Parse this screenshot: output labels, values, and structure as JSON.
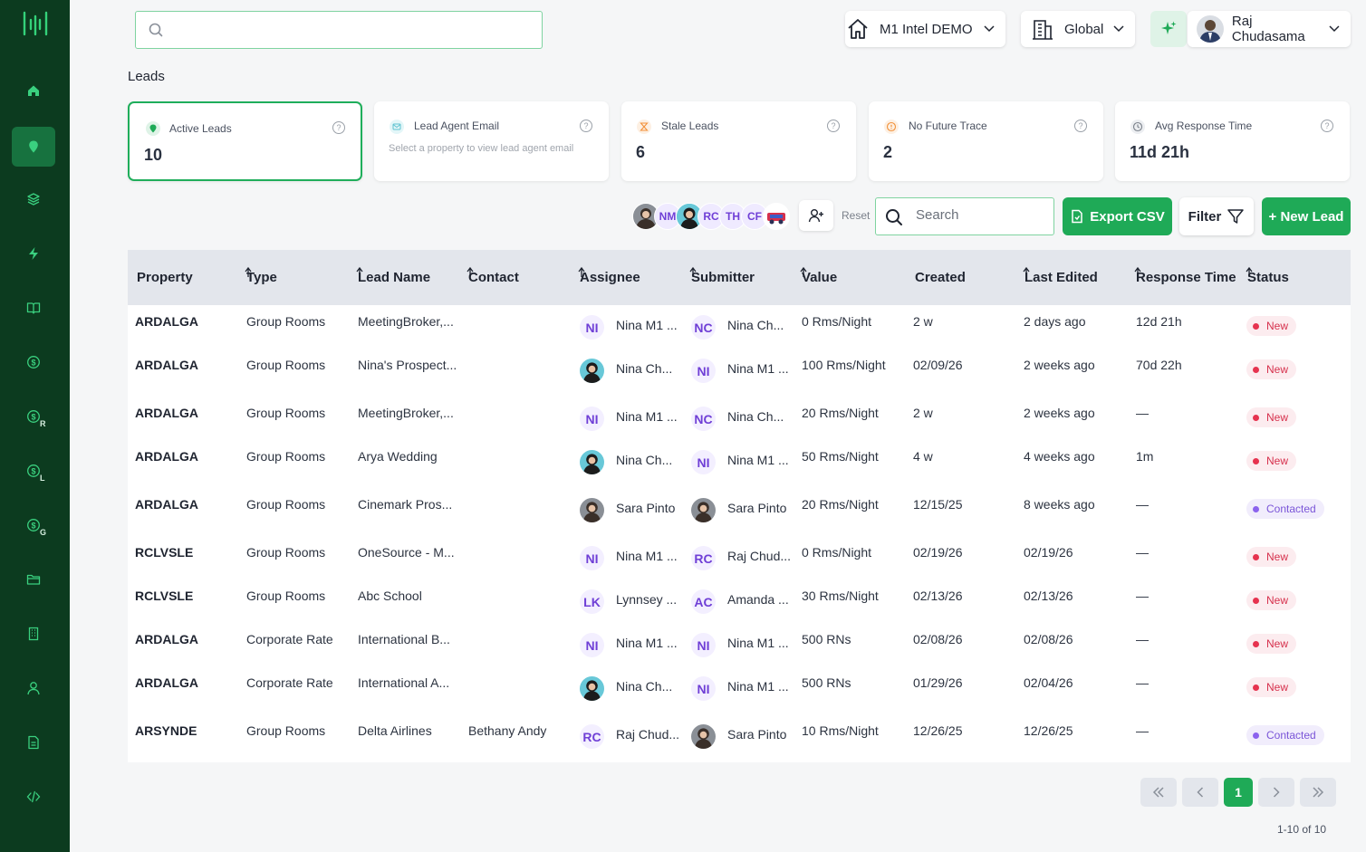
{
  "nav": {
    "items": [
      {
        "name": "home",
        "sub": ""
      },
      {
        "name": "leads",
        "sub": ""
      },
      {
        "name": "layers",
        "sub": ""
      },
      {
        "name": "bolt",
        "sub": ""
      },
      {
        "name": "book",
        "sub": ""
      },
      {
        "name": "dollar",
        "sub": ""
      },
      {
        "name": "dollar-r",
        "sub": "R"
      },
      {
        "name": "dollar-l",
        "sub": "L"
      },
      {
        "name": "dollar-g",
        "sub": "G"
      },
      {
        "name": "folder",
        "sub": ""
      },
      {
        "name": "building",
        "sub": ""
      },
      {
        "name": "user",
        "sub": ""
      },
      {
        "name": "file",
        "sub": ""
      },
      {
        "name": "code",
        "sub": ""
      }
    ],
    "active_index": 1
  },
  "header": {
    "search_placeholder": "",
    "property_select": "M1 Intel DEMO",
    "scope_select": "Global",
    "user_name": "Raj Chudasama"
  },
  "page": {
    "title": "Leads"
  },
  "cards": {
    "active_leads": {
      "label": "Active Leads",
      "value": "10"
    },
    "lead_agent_email": {
      "label": "Lead Agent Email",
      "sub": "Select a property to view lead agent email"
    },
    "stale_leads": {
      "label": "Stale Leads",
      "value": "6"
    },
    "no_future_trace": {
      "label": "No Future Trace",
      "value": "2"
    },
    "avg_response": {
      "label": "Avg Response Time",
      "value": "11d 21h"
    }
  },
  "toolbar": {
    "avatars": [
      "NM",
      "RC",
      "TH",
      "CF"
    ],
    "reset_label": "Reset",
    "search_placeholder": "Search",
    "export_label": "Export CSV",
    "filter_label": "Filter",
    "new_lead_label": "+ New Lead"
  },
  "table": {
    "columns": [
      "Property",
      "Type",
      "Lead Name",
      "Contact",
      "Assignee",
      "Submitter",
      "Value",
      "Created",
      "Last Edited",
      "Response Time",
      "Status"
    ],
    "rows": [
      {
        "property": "ARDALGA",
        "type": "Group Rooms",
        "lead": "MeetingBroker,...",
        "contact": "",
        "assignee": "Nina M1 ...",
        "assignee_ini": "NI",
        "submitter": "Nina Ch...",
        "submitter_ini": "NC",
        "value": "0 Rms/Night",
        "created": "2 w",
        "edited": "2 days ago",
        "response": "12d 21h",
        "status": "New"
      },
      {
        "property": "ARDALGA",
        "type": "Group Rooms",
        "lead": "Nina's Prospect...",
        "contact": "",
        "assignee": "Nina Ch...",
        "assignee_ini": "",
        "submitter": "Nina M1 ...",
        "submitter_ini": "NI",
        "value": "100 Rms/Night",
        "created": "02/09/26",
        "edited": "2 weeks ago",
        "response": "70d 22h",
        "status": "New"
      },
      {
        "property": "ARDALGA",
        "type": "Group Rooms",
        "lead": "MeetingBroker,...",
        "contact": "",
        "assignee": "Nina M1 ...",
        "assignee_ini": "NI",
        "submitter": "Nina Ch...",
        "submitter_ini": "NC",
        "value": "20 Rms/Night",
        "created": "2 w",
        "edited": "2 weeks ago",
        "response": "—",
        "status": "New"
      },
      {
        "property": "ARDALGA",
        "type": "Group Rooms",
        "lead": "Arya Wedding",
        "contact": "",
        "assignee": "Nina Ch...",
        "assignee_ini": "",
        "submitter": "Nina M1 ...",
        "submitter_ini": "NI",
        "value": "50 Rms/Night",
        "created": "4 w",
        "edited": "4 weeks ago",
        "response": "1m",
        "status": "New"
      },
      {
        "property": "ARDALGA",
        "type": "Group Rooms",
        "lead": "Cinemark Pros...",
        "contact": "",
        "assignee": "Sara Pinto",
        "assignee_ini": "",
        "submitter": "Sara Pinto",
        "submitter_ini": "",
        "value": "20 Rms/Night",
        "created": "12/15/25",
        "edited": "8 weeks ago",
        "response": "—",
        "status": "Contacted"
      },
      {
        "property": "RCLVSLE",
        "type": "Group Rooms",
        "lead": "OneSource - M...",
        "contact": "",
        "assignee": "Nina M1 ...",
        "assignee_ini": "NI",
        "submitter": "Raj Chud...",
        "submitter_ini": "RC",
        "value": "0 Rms/Night",
        "created": "02/19/26",
        "edited": "02/19/26",
        "response": "—",
        "status": "New"
      },
      {
        "property": "RCLVSLE",
        "type": "Group Rooms",
        "lead": "Abc School",
        "contact": "",
        "assignee": "Lynnsey ...",
        "assignee_ini": "LK",
        "submitter": "Amanda ...",
        "submitter_ini": "AC",
        "value": "30 Rms/Night",
        "created": "02/13/26",
        "edited": "02/13/26",
        "response": "—",
        "status": "New"
      },
      {
        "property": "ARDALGA",
        "type": "Corporate Rate",
        "lead": "International B...",
        "contact": "",
        "assignee": "Nina M1 ...",
        "assignee_ini": "NI",
        "submitter": "Nina M1 ...",
        "submitter_ini": "NI",
        "value": "500 RNs",
        "created": "02/08/26",
        "edited": "02/08/26",
        "response": "—",
        "status": "New"
      },
      {
        "property": "ARDALGA",
        "type": "Corporate Rate",
        "lead": "International A...",
        "contact": "",
        "assignee": "Nina Ch...",
        "assignee_ini": "",
        "submitter": "Nina M1 ...",
        "submitter_ini": "NI",
        "value": "500 RNs",
        "created": "01/29/26",
        "edited": "02/04/26",
        "response": "—",
        "status": "New"
      },
      {
        "property": "ARSYNDE",
        "type": "Group Rooms",
        "lead": "Delta Airlines",
        "contact": "Bethany Andy",
        "assignee": "Raj Chud...",
        "assignee_ini": "RC",
        "submitter": "Sara Pinto",
        "submitter_ini": "",
        "value": "10 Rms/Night",
        "created": "12/26/25",
        "edited": "12/26/25",
        "response": "—",
        "status": "Contacted"
      }
    ]
  },
  "pagination": {
    "current": "1",
    "info": "1-10 of 10"
  },
  "colors": {
    "sidebar": "#0c3b1f",
    "accent": "#1faa57",
    "new": "#d6304c",
    "contacted": "#7a55d8"
  }
}
